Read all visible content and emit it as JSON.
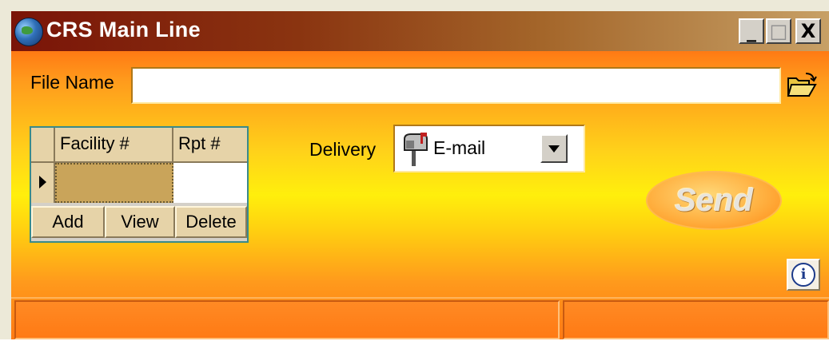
{
  "window": {
    "title": "CRS Main Line",
    "controls": {
      "minimize": "_",
      "maximize": "□",
      "close": "X"
    }
  },
  "file": {
    "label": "File Name",
    "value": "",
    "browse_icon": "folder-open-icon"
  },
  "grid": {
    "columns": [
      "Facility #",
      "Rpt #"
    ],
    "rows": [
      {
        "facility": "",
        "rpt": ""
      }
    ],
    "buttons": {
      "add": "Add",
      "view": "View",
      "delete": "Delete"
    }
  },
  "delivery": {
    "label": "Delivery",
    "selected": "E-mail",
    "icon": "mailbox-icon"
  },
  "send": {
    "label": "Send"
  },
  "info": {
    "glyph": "i"
  },
  "colors": {
    "titlebar_start": "#7a1408",
    "titlebar_end": "#c7a066",
    "background_top": "#ff7a14",
    "background_mid": "#ffef0c",
    "grid_border": "#3a8a8a"
  }
}
